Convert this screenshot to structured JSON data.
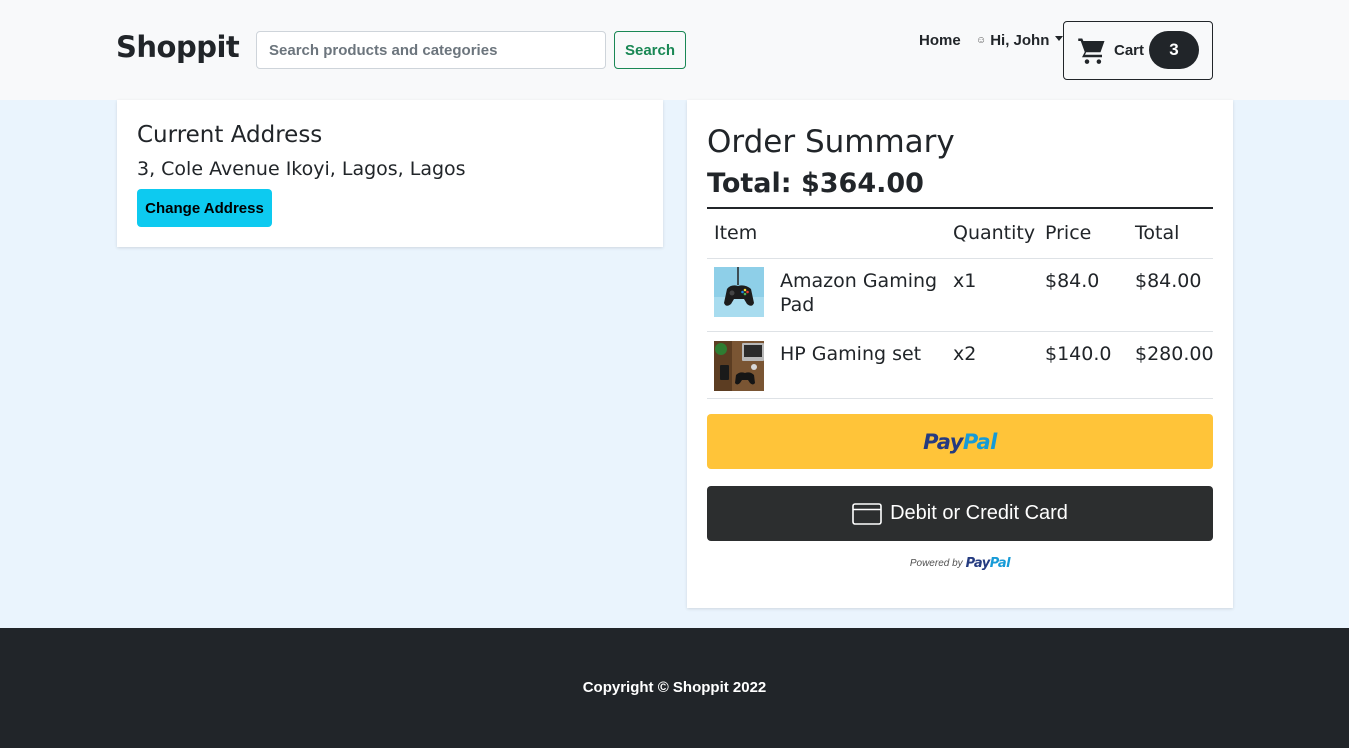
{
  "navbar": {
    "brand": "Shoppit",
    "search_placeholder": "Search products and categories",
    "search_button": "Search",
    "home_link": "Home",
    "user_greeting": "Hi, John",
    "cart_label": "Cart",
    "cart_count": "3"
  },
  "address": {
    "title": "Current Address",
    "text": "3, Cole Avenue Ikoyi, Lagos, Lagos",
    "change_button": "Change Address"
  },
  "order": {
    "title": "Order Summary",
    "total": "Total: $364.00",
    "columns": [
      "Item",
      "Quantity",
      "Price",
      "Total"
    ],
    "items": [
      {
        "name": "Amazon Gaming Pad",
        "qty": "x1",
        "price": "$84.0",
        "total": "$84.00",
        "image": "gamepad-image"
      },
      {
        "name": "HP Gaming set",
        "qty": "x2",
        "price": "$140.0",
        "total": "$280.00",
        "image": "gaming-set-image"
      }
    ]
  },
  "payment": {
    "paypal_pay": "Pay",
    "paypal_pal": "Pal",
    "card_button": "Debit or Credit Card",
    "powered_by": "Powered by"
  },
  "footer": {
    "copyright": "Copyright © Shoppit 2022"
  },
  "colors": {
    "page_bg": "#eaf4fd",
    "navbar_bg": "#f8f9fa",
    "accent_green": "#198754",
    "info_cyan": "#0dcaf0",
    "paypal_yellow": "#ffc439",
    "paypal_dark_blue": "#253b80",
    "paypal_light_blue": "#179bd7",
    "card_button_bg": "#2c2e2f",
    "footer_bg": "#212529"
  }
}
